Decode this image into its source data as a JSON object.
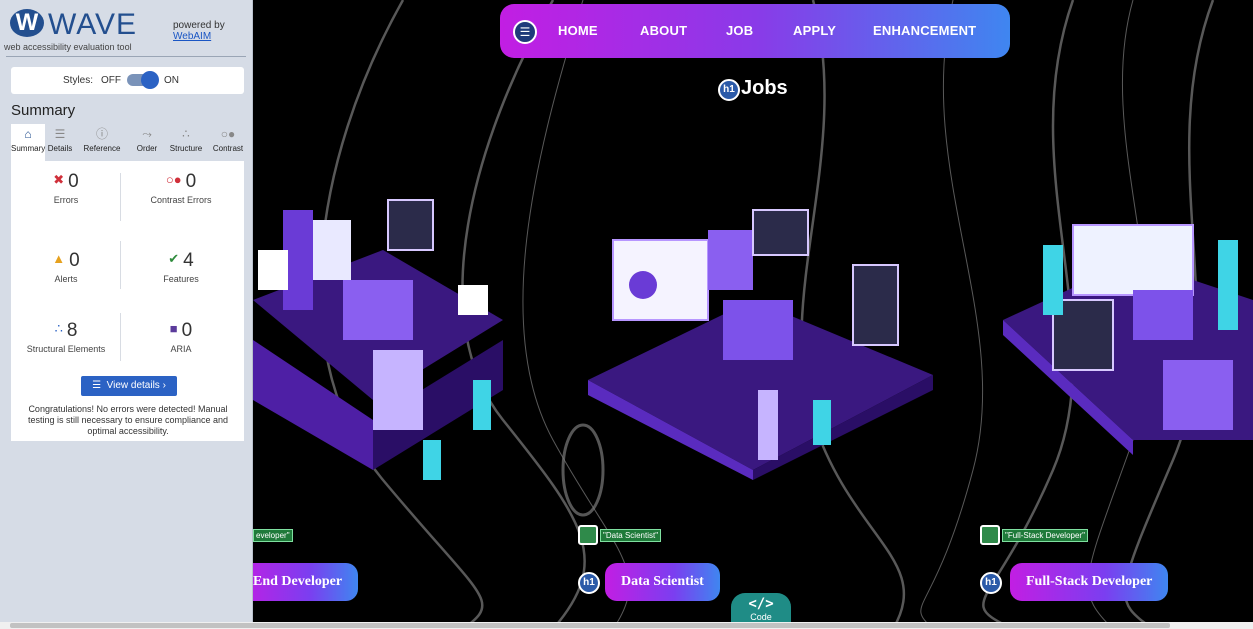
{
  "wave": {
    "logo_mark": "W",
    "logo_word": "WAVE",
    "tagline": "web accessibility evaluation tool",
    "powered_by": "powered by",
    "webaim_link": "WebAIM",
    "styles_label": "Styles:",
    "styles_off": "OFF",
    "styles_on": "ON",
    "summary_title": "Summary",
    "tabs": [
      {
        "label": "Summary",
        "icon": "home-icon",
        "glyph": "⌂"
      },
      {
        "label": "Details",
        "icon": "list-icon",
        "glyph": "☰"
      },
      {
        "label": "Reference",
        "icon": "info-icon",
        "glyph": "ⓘ"
      },
      {
        "label": "Order",
        "icon": "order-icon",
        "glyph": "⤳"
      },
      {
        "label": "Structure",
        "icon": "structure-icon",
        "glyph": "∴"
      },
      {
        "label": "Contrast",
        "icon": "contrast-icon",
        "glyph": "○●"
      }
    ],
    "stats": {
      "errors": {
        "count": "0",
        "label": "Errors",
        "glyph": "✖",
        "color": "#d0303a"
      },
      "contrast_errors": {
        "count": "0",
        "label": "Contrast Errors",
        "glyph": "○●",
        "color": "#d0303a"
      },
      "alerts": {
        "count": "0",
        "label": "Alerts",
        "glyph": "▲",
        "color": "#e6a11e"
      },
      "features": {
        "count": "4",
        "label": "Features",
        "glyph": "✔",
        "color": "#2e8b3c"
      },
      "structural": {
        "count": "8",
        "label": "Structural Elements",
        "glyph": "∴",
        "color": "#2b62c4"
      },
      "aria": {
        "count": "0",
        "label": "ARIA",
        "glyph": "■",
        "color": "#5b3b9b"
      }
    },
    "view_details": "View details ›",
    "congrats": "Congratulations! No errors were detected! Manual testing is still necessary to ensure compliance and optimal accessibility."
  },
  "nav": {
    "items": [
      "HOME",
      "ABOUT",
      "JOB",
      "APPLY",
      "ENHANCEMENT"
    ]
  },
  "page_title": "Jobs",
  "h1_badge": "h1",
  "jobs": [
    {
      "alt_text": "eveloper\"",
      "button": "End Developer"
    },
    {
      "alt_text": "\"Data Scientist\"",
      "button": "Data Scientist"
    },
    {
      "alt_text": "\"Full-Stack Developer\"",
      "button": "Full-Stack Developer"
    }
  ],
  "code_tab": {
    "symbol": "</>",
    "label": "Code"
  },
  "colors": {
    "accent_purple": "#c21ee3",
    "accent_blue": "#3f86f0",
    "wave_blue": "#2b62c4"
  }
}
